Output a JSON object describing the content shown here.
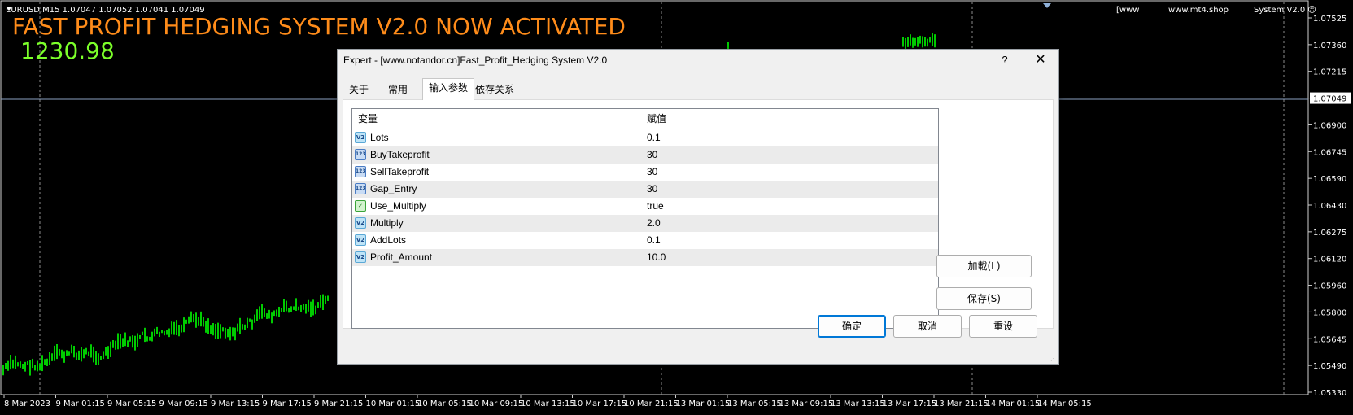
{
  "chart": {
    "symbol_info": "EURUSD,M15  1.07047 1.07052 1.07041 1.07049",
    "headline": "FAST PROFIT HEDGING SYSTEM V2.0 NOW ACTIVATED",
    "balance": "1230.98",
    "top_right": {
      "www_link": "[www",
      "site": "www.mt4.shop",
      "ea_name": "System V2.0"
    },
    "current_price": "1.07049",
    "price_axis": [
      "1.07525",
      "1.07360",
      "1.07215",
      "1.07049",
      "1.06900",
      "1.06745",
      "1.06590",
      "1.06430",
      "1.06275",
      "1.06120",
      "1.05960",
      "1.05800",
      "1.05645",
      "1.05490",
      "1.05330"
    ],
    "time_axis": [
      "8 Mar 2023",
      "9 Mar 01:15",
      "9 Mar 05:15",
      "9 Mar 09:15",
      "9 Mar 13:15",
      "9 Mar 17:15",
      "9 Mar 21:15",
      "10 Mar 01:15",
      "10 Mar 05:15",
      "10 Mar 09:15",
      "10 Mar 13:15",
      "10 Mar 17:15",
      "10 Mar 21:15",
      "13 Mar 01:15",
      "13 Mar 05:15",
      "13 Mar 09:15",
      "13 Mar 13:15",
      "13 Mar 17:15",
      "13 Mar 21:15",
      "14 Mar 01:15",
      "14 Mar 05:15"
    ],
    "colors": {
      "background": "#000000",
      "candles": "#00ff00",
      "headline": "#ff8c1a",
      "balance": "#7cff2a",
      "grid": "#8a8a8a"
    }
  },
  "dialog": {
    "title": "Expert - [www.notandor.cn]Fast_Profit_Hedging System V2.0",
    "help_label": "?",
    "close_label": "✕",
    "tabs": [
      {
        "label": "关于",
        "active": false
      },
      {
        "label": "常用",
        "active": false
      },
      {
        "label": "输入参数",
        "active": true
      },
      {
        "label": "依存关系",
        "active": false
      }
    ],
    "columns": {
      "variable": "变量",
      "value": "赋值"
    },
    "params": [
      {
        "icon": "double-type-icon",
        "icon_text": "V2",
        "name": "Lots",
        "value": "0.1"
      },
      {
        "icon": "integer-type-icon",
        "icon_text": "123",
        "name": "BuyTakeprofit",
        "value": "30"
      },
      {
        "icon": "integer-type-icon",
        "icon_text": "123",
        "name": "SellTakeprofit",
        "value": "30"
      },
      {
        "icon": "integer-type-icon",
        "icon_text": "123",
        "name": "Gap_Entry",
        "value": "30"
      },
      {
        "icon": "bool-type-icon",
        "icon_text": "✓",
        "name": "Use_Multiply",
        "value": "true"
      },
      {
        "icon": "double-type-icon",
        "icon_text": "V2",
        "name": "Multiply",
        "value": "2.0"
      },
      {
        "icon": "double-type-icon",
        "icon_text": "V2",
        "name": "AddLots",
        "value": "0.1"
      },
      {
        "icon": "double-type-icon",
        "icon_text": "V2",
        "name": "Profit_Amount",
        "value": "10.0"
      }
    ],
    "buttons": {
      "load": "加載(L)",
      "save": "保存(S)",
      "ok": "确定",
      "cancel": "取消",
      "reset": "重设"
    }
  }
}
